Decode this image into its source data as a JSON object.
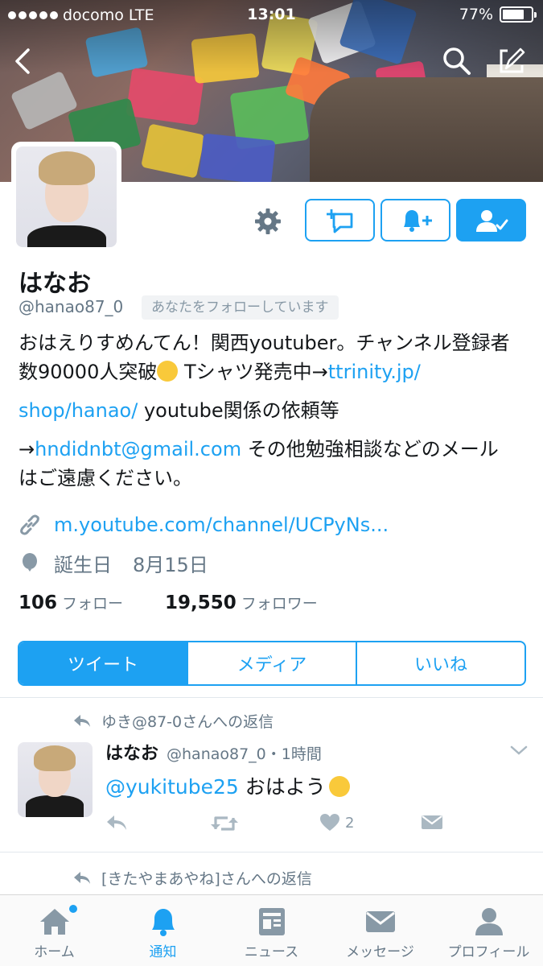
{
  "status_bar": {
    "carrier": "docomo",
    "network": "LTE",
    "time": "13:01",
    "battery": "77%",
    "battery_level": 0.77
  },
  "profile": {
    "name": "はなお",
    "handle": "@hanao87_0",
    "follows_you": "あなたをフォローしています",
    "bio_line1_text": "おはえりすめんてん！関西youtuber。チャンネル登録者数90000人突破",
    "bio_line1_text2": " Tシャツ発売中→",
    "bio_link1": "ttrinity.jp/",
    "bio_link1b": "shop/hanao/",
    "bio_text3": " youtube関係の依頼等",
    "bio_arrow": "→",
    "bio_email": "hndidnbt@gmail.com",
    "bio_text4": " その他勉強相談などのメール",
    "bio_text5": "はご遠慮ください。",
    "website": "m.youtube.com/channel/UCPyNs...",
    "birthday_label": "誕生日",
    "birthday_value": "8月15日",
    "following_count": "106",
    "following_label": "フォロー",
    "followers_count": "19,550",
    "followers_label": "フォロワー"
  },
  "tabs": [
    {
      "label": "ツイート",
      "active": true
    },
    {
      "label": "メディア",
      "active": false
    },
    {
      "label": "いいね",
      "active": false
    }
  ],
  "tweet": {
    "reply_context": "ゆき@87-0さんへの返信",
    "name": "はなお",
    "handle_time": "@hanao87_0・1時間",
    "mention": "@yukitube25",
    "text": " おはよう",
    "like_count": "2"
  },
  "next_reply_context": "[きたやまあやね]さんへの返信",
  "tabbar": [
    {
      "label": "ホーム",
      "icon": "home-icon"
    },
    {
      "label": "通知",
      "icon": "bell-icon"
    },
    {
      "label": "ニュース",
      "icon": "news-icon"
    },
    {
      "label": "メッセージ",
      "icon": "envelope-icon"
    },
    {
      "label": "プロフィール",
      "icon": "person-icon"
    }
  ],
  "colors": {
    "accent": "#1da1f2",
    "secondary_text": "#657786"
  }
}
